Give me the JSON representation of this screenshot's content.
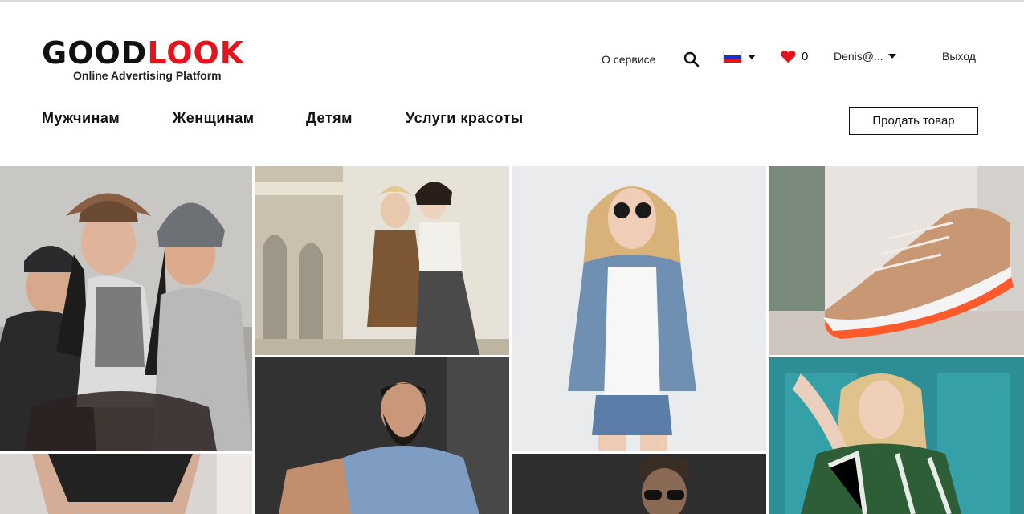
{
  "header": {
    "logo": {
      "part1": "GOOD",
      "part2": "LOOK",
      "tagline": "Online Advertising Platform"
    },
    "about_link": "О сервисе",
    "search_icon": "search-icon",
    "language": {
      "icon": "flag-icon",
      "colors": [
        "#ffffff",
        "#1434cc",
        "#e3141e"
      ]
    },
    "favorites": {
      "icon": "heart-icon",
      "count": "0",
      "color": "#e3141e"
    },
    "user": {
      "name": "Denis@..."
    },
    "logout": "Выход"
  },
  "nav": {
    "categories": [
      "Мужчинам",
      "Женщинам",
      "Детям",
      "Услуги красоты"
    ],
    "sell_button": "Продать товар"
  },
  "gallery": {
    "tiles": [
      {
        "name": "tile-three-women-hats"
      },
      {
        "name": "tile-two-women-vintage"
      },
      {
        "name": "tile-woman-denim-jacket"
      },
      {
        "name": "tile-sneaker"
      },
      {
        "name": "tile-lace-lingerie"
      },
      {
        "name": "tile-bearded-man"
      },
      {
        "name": "tile-man-sunglasses"
      },
      {
        "name": "tile-blonde-woman-teal-door"
      }
    ]
  }
}
